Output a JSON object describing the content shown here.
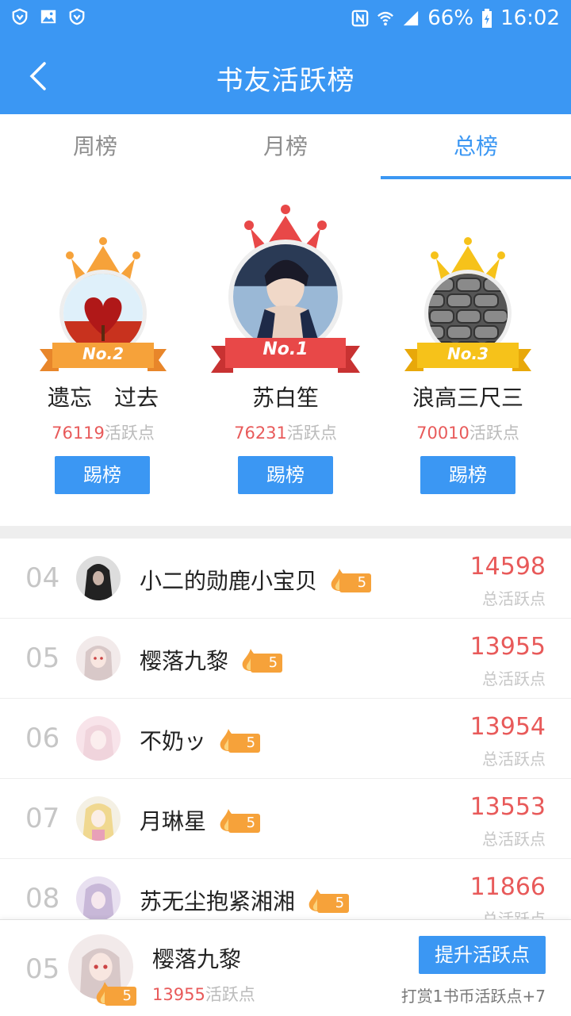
{
  "status": {
    "battery": "66%",
    "time": "16:02"
  },
  "header": {
    "title": "书友活跃榜"
  },
  "tabs": [
    {
      "label": "周榜"
    },
    {
      "label": "月榜"
    },
    {
      "label": "总榜"
    }
  ],
  "active_tab": "总榜",
  "podium": [
    {
      "badge": "No.1",
      "name": "苏白笙",
      "points": "76231",
      "unit": "活跃点",
      "button": "踢榜"
    },
    {
      "badge": "No.2",
      "name": "遗忘　过去",
      "points": "76119",
      "unit": "活跃点",
      "button": "踢榜"
    },
    {
      "badge": "No.3",
      "name": "浪高三尺三",
      "points": "70010",
      "unit": "活跃点",
      "button": "踢榜"
    }
  ],
  "list": [
    {
      "rank": "04",
      "name": "小二的勋鹿小宝贝",
      "level": "5",
      "score": "14598",
      "label": "总活跃点"
    },
    {
      "rank": "05",
      "name": "樱落九黎",
      "level": "5",
      "score": "13955",
      "label": "总活跃点"
    },
    {
      "rank": "06",
      "name": "不奶ッ",
      "level": "5",
      "score": "13954",
      "label": "总活跃点"
    },
    {
      "rank": "07",
      "name": "月琳星",
      "level": "5",
      "score": "13553",
      "label": "总活跃点"
    },
    {
      "rank": "08",
      "name": "苏无尘抱紧湘湘",
      "level": "5",
      "score": "11866",
      "label": "总活跃点"
    }
  ],
  "me": {
    "rank": "05",
    "name": "樱落九黎",
    "level": "5",
    "points": "13955",
    "unit": "活跃点",
    "button": "提升活跃点",
    "tip": "打赏1书币活跃点+7"
  },
  "colors": {
    "primary": "#3b97f3",
    "score": "#e85a5a",
    "badge_gold": "#f6a23a",
    "ribbon_red": "#e84848"
  }
}
